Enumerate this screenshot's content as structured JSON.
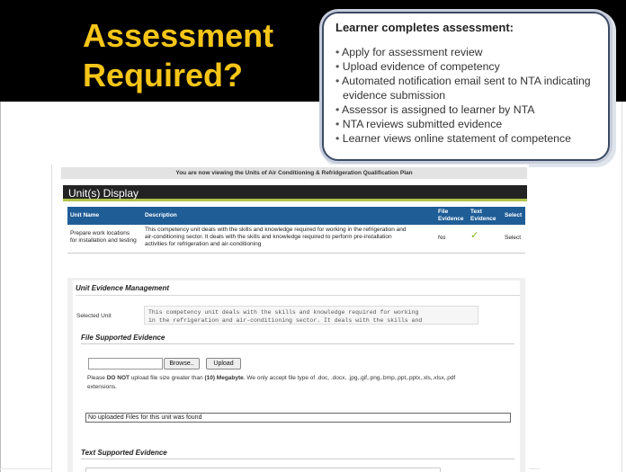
{
  "slide": {
    "title_line1": "Assessment",
    "title_line2": "Required?"
  },
  "callout": {
    "title": "Learner completes assessment:",
    "items": [
      "Apply for assessment review",
      "Upload evidence of competency",
      "Automated notification email sent to NTA indicating evidence submission",
      "Assessor is assigned to learner by NTA",
      "NTA reviews submitted evidence",
      "Learner views online statement of competence"
    ]
  },
  "app": {
    "banner": "You are now viewing the Units of Air Conditioning & Refridgeration Qualification Plan",
    "section_title": "Unit(s) Display",
    "table": {
      "headers": {
        "unit_name": "Unit Name",
        "description": "Description",
        "file_evidence_1": "File",
        "file_evidence_2": "Evidence",
        "text_evidence_1": "Text",
        "text_evidence_2": "Evidence",
        "select": "Select"
      },
      "rows": [
        {
          "unit_name_1": "Prepare work locations",
          "unit_name_2": "for installation and testing",
          "description_1": "This competency unit deals with the skills and knowledge required for working in the refrigeration and",
          "description_2": "air-conditioning sector. It deals with the skills and knowledge required to perform pre-installation",
          "description_3": "activities for refrigeration and air-conditioning",
          "file_evidence": "No",
          "text_evidence_icon": "check-icon",
          "text_evidence_glyph": "✓",
          "select": "Select"
        }
      ]
    },
    "evidence": {
      "title": "Unit Evidence Management",
      "selected_unit_label": "Selected Unit",
      "selected_unit_text_1": "This competency unit deals with the skills and knowledge required for working",
      "selected_unit_text_2": "in the refrigeration and air-conditioning sector. It deals with the skills and",
      "file_section_title": "File Supported Evidence",
      "browse_label": "Browse..",
      "upload_label": "Upload",
      "note_prefix": "Please ",
      "note_do_not": "DO NOT",
      "note_mid": " upload file size greater than ",
      "note_size": "(10) Megabyte",
      "note_suffix": ". We only accept file type of  .doc, .docx, .jpg,.gif,.png,.bmp,.ppt,.pptx,.xls,.xlsx,.pdf",
      "note_line2": "extensions.",
      "no_files_text": "No uploaded Files for this unit was found",
      "text_section_title": "Text Supported Evidence"
    }
  },
  "colors": {
    "title_yellow": "#f5c518",
    "header_blue": "#1f5d97",
    "check_green": "#7fb51a",
    "bar_dark": "#232323"
  }
}
